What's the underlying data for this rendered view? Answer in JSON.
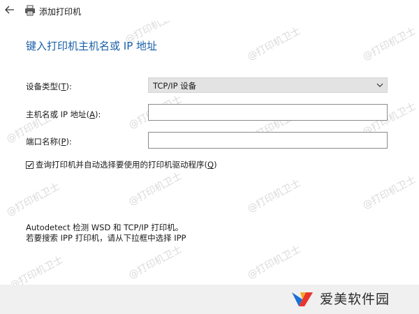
{
  "window": {
    "title": "添加打印机"
  },
  "page": {
    "heading": "键入打印机主机名或 IP 地址"
  },
  "form": {
    "device_type": {
      "label": "设备类型",
      "mnemonic": "T",
      "value": "TCP/IP 设备"
    },
    "hostname": {
      "label": "主机名或 IP 地址",
      "mnemonic": "A",
      "value": ""
    },
    "port_name": {
      "label": "端口名称",
      "mnemonic": "P",
      "value": ""
    },
    "auto_select": {
      "label": "查询打印机并自动选择要使用的打印机驱动程序",
      "mnemonic": "Q",
      "checked": true
    }
  },
  "info": {
    "line1": "Autodetect 检测 WSD 和 TCP/IP 打印机。",
    "line2": "若要搜索 IPP 打印机，请从下拉框中选择 IPP"
  },
  "footer": {
    "brand_name": "爱美软件园"
  },
  "watermark": {
    "text": "@打印机卫士"
  },
  "colors": {
    "heading": "#1a5fa8",
    "footer_bg": "#f0f0f0",
    "select_bg": "#e3e3e3"
  },
  "icons": {
    "back": "arrow-left-icon",
    "printer": "printer-icon",
    "chevron": "chevron-down-icon",
    "check": "checkmark-icon",
    "brand_logo": "brand-logo-icon"
  }
}
